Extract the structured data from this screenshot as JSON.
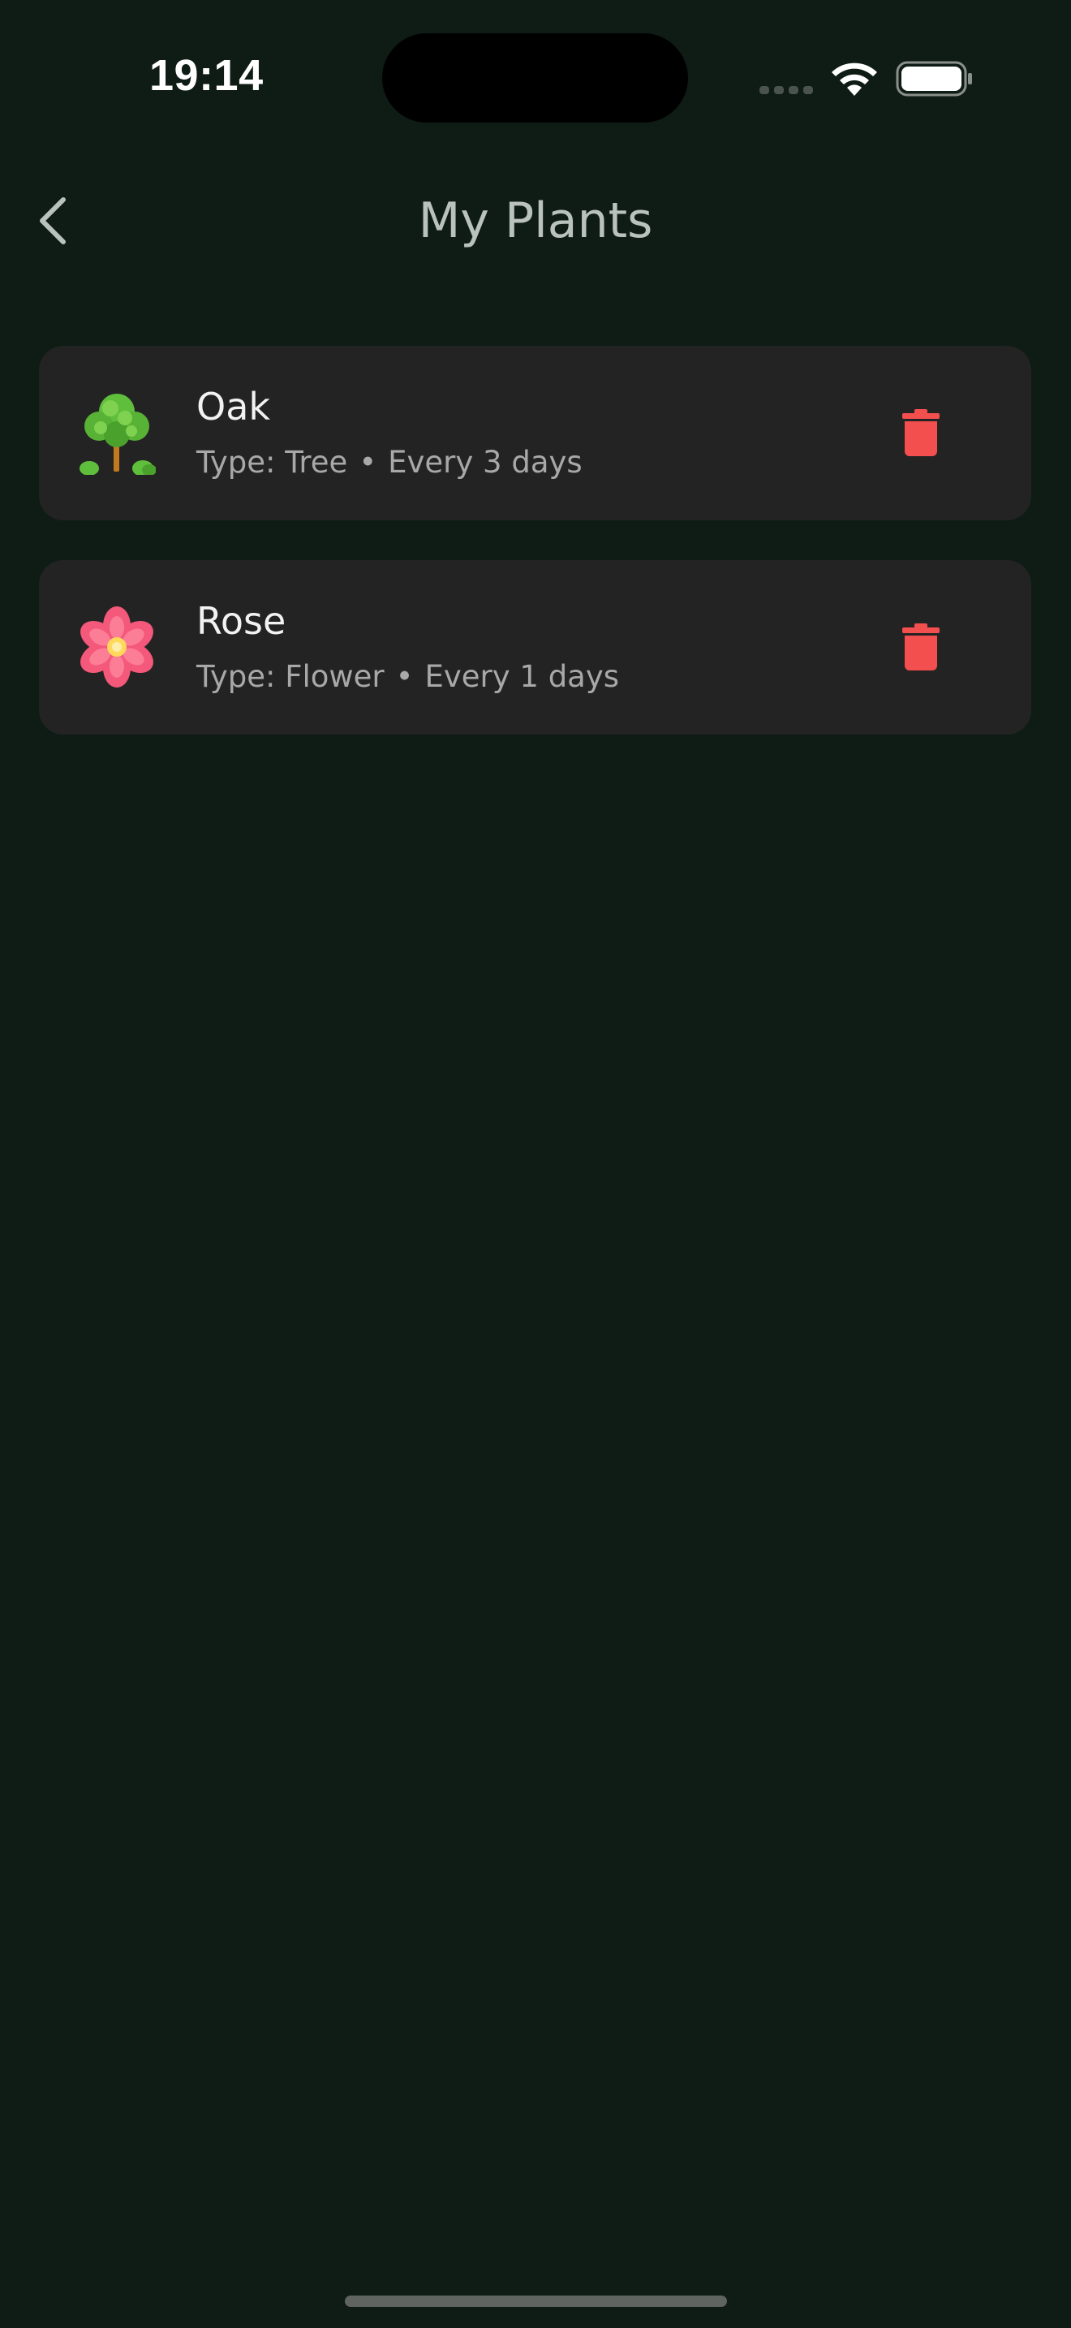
{
  "status_bar": {
    "time": "19:14",
    "icons": [
      "signal-dots-icon",
      "wifi-icon",
      "battery-icon"
    ]
  },
  "nav": {
    "title": "My Plants",
    "back_icon": "chevron-left-icon"
  },
  "plants": [
    {
      "name": "Oak",
      "type_text": "Type: Tree",
      "separator": "•",
      "schedule_text": "Every 3 days",
      "icon": "tree-icon",
      "delete_icon": "trash-icon"
    },
    {
      "name": "Rose",
      "type_text": "Type: Flower",
      "separator": "•",
      "schedule_text": "Every 1 days",
      "icon": "flower-icon",
      "delete_icon": "trash-icon"
    }
  ],
  "colors": {
    "background": "#0e1c15",
    "card": "#232323",
    "title": "#b9c2bb",
    "delete": "#f44f4f"
  }
}
